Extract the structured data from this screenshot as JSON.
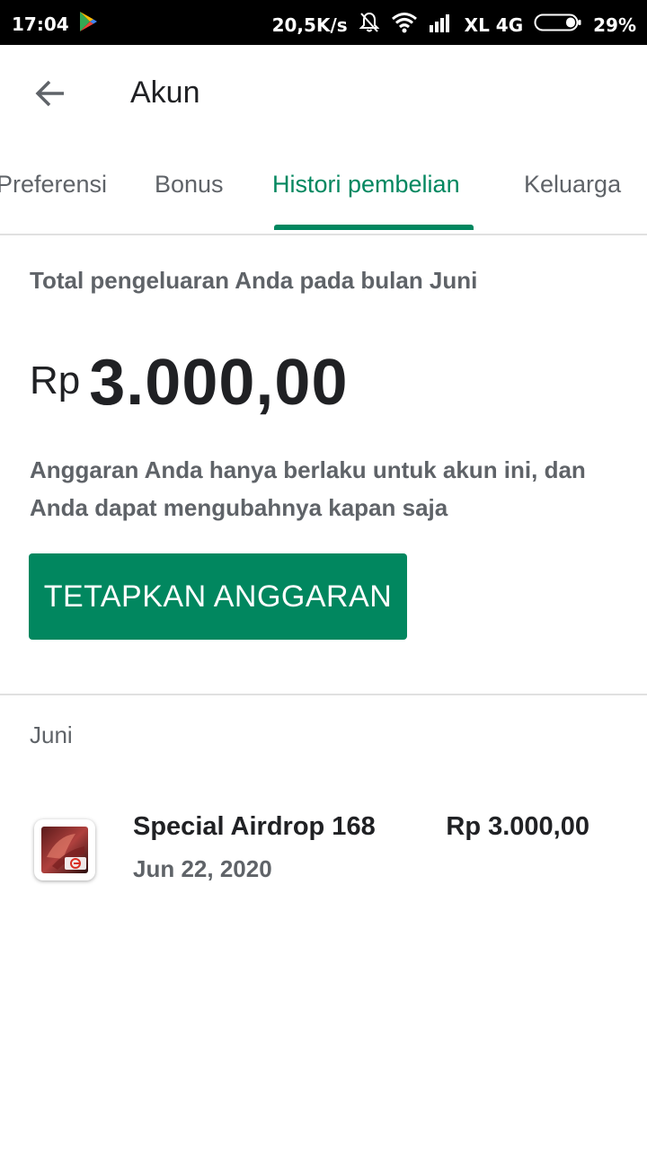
{
  "status_bar": {
    "time": "17:04",
    "network_speed": "20,5K/s",
    "carrier": "XL 4G",
    "battery": "29%"
  },
  "app_bar": {
    "title": "Akun",
    "back_icon": "arrow-back-icon"
  },
  "tabs": [
    {
      "label": "Preferensi",
      "active": false
    },
    {
      "label": "Bonus",
      "active": false
    },
    {
      "label": "Histori pembelian",
      "active": true
    },
    {
      "label": "Keluarga",
      "active": false
    }
  ],
  "summary": {
    "label": "Total pengeluaran Anda pada bulan Juni",
    "currency": "Rp",
    "amount": "3.000,00",
    "note": "Anggaran Anda hanya berlaku untuk akun ini, dan Anda dapat mengubahnya kapan saja",
    "button_label": "TETAPKAN ANGGARAN"
  },
  "history": {
    "month": "Juni",
    "items": [
      {
        "title": "Special Airdrop 168",
        "date": "Jun 22, 2020",
        "price": "Rp 3.000,00",
        "icon": "game-app-icon"
      }
    ]
  },
  "colors": {
    "accent": "#01875f",
    "text_primary": "#202124",
    "text_secondary": "#5f6368",
    "divider": "#e0e0e0"
  }
}
